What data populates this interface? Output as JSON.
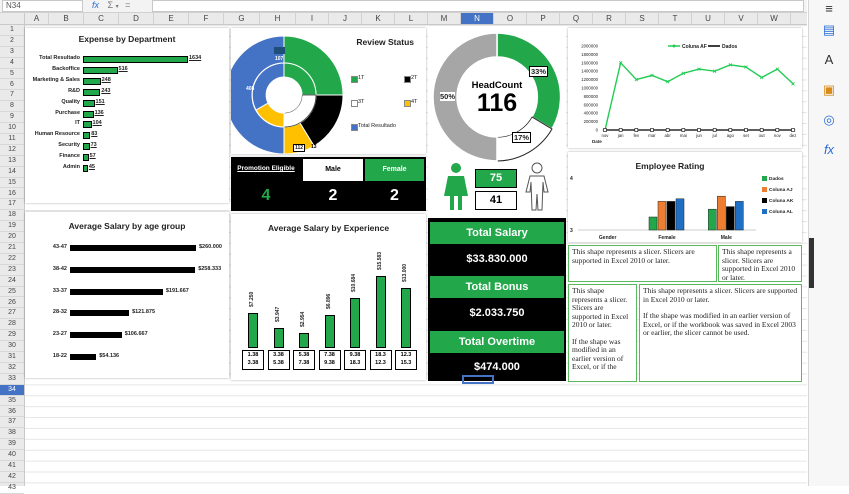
{
  "formula_bar": {
    "name_box": "N34",
    "fx_label": "fx",
    "sum_symbol": "Σ",
    "eq_symbol": "="
  },
  "columns": [
    "A",
    "B",
    "C",
    "D",
    "E",
    "F",
    "G",
    "H",
    "I",
    "J",
    "K",
    "L",
    "M",
    "N",
    "O",
    "P",
    "Q",
    "R",
    "S",
    "T",
    "U",
    "V",
    "W"
  ],
  "selected_column": "N",
  "rows": [
    "1",
    "2",
    "3",
    "4",
    "5",
    "6",
    "7",
    "8",
    "9",
    "10",
    "11",
    "12",
    "13",
    "14",
    "15",
    "16",
    "17",
    "18",
    "19",
    "20",
    "21",
    "22",
    "23",
    "24",
    "25",
    "26",
    "27",
    "28",
    "29",
    "30",
    "31",
    "32",
    "33",
    "34",
    "35",
    "36",
    "37",
    "38",
    "39",
    "40",
    "41",
    "42",
    "43"
  ],
  "selected_row": "34",
  "expense": {
    "title": "Expense by Department",
    "items": [
      {
        "label": "Total Resultado",
        "value": 1634
      },
      {
        "label": "Backoffice",
        "value": 516
      },
      {
        "label": "Marketing & Sales",
        "value": 248
      },
      {
        "label": "R&D",
        "value": 243
      },
      {
        "label": "Quality",
        "value": 151
      },
      {
        "label": "Purchase",
        "value": 136
      },
      {
        "label": "IT",
        "value": 104
      },
      {
        "label": "Human Resource",
        "value": 83
      },
      {
        "label": "Security",
        "value": 73
      },
      {
        "label": "Finance",
        "value": 57
      },
      {
        "label": "Admin",
        "value": 45
      }
    ],
    "bar_color": "#22a84a"
  },
  "review": {
    "title": "Review Status",
    "legend": [
      {
        "label": "1T",
        "color": "#22a84a"
      },
      {
        "label": "2T",
        "color": "#000000"
      },
      {
        "label": "3T",
        "color": "#ffffff"
      },
      {
        "label": "4T",
        "color": "#ffc000"
      },
      {
        "label": "Total Resultado",
        "color": "#4472c4"
      }
    ],
    "inner_labels": [
      "107",
      "13"
    ],
    "outer_labels": [
      "408",
      "112"
    ]
  },
  "headcount": {
    "title": "HeadCount",
    "value": "116",
    "pct_left": "50%",
    "pct_top": "33%",
    "pct_bottom": "17%",
    "female": "75",
    "male": "41"
  },
  "line_chart": {
    "legend": [
      "Coluna AF",
      "Dados"
    ],
    "x_label": "Date",
    "ylabels": [
      "2000000",
      "1800000",
      "1600000",
      "1400000",
      "1200000",
      "1000000",
      "800000",
      "600000",
      "400000",
      "200000",
      "0"
    ],
    "months": [
      "nov",
      "jan",
      "fev",
      "mar",
      "abr",
      "mai",
      "jun",
      "jul",
      "ago",
      "set",
      "out",
      "nov",
      "dez"
    ],
    "first_month_label": "nov",
    "chart_data": {
      "type": "line",
      "x": [
        "nov",
        "jan",
        "fev",
        "mar",
        "abr",
        "mai",
        "jun",
        "jul",
        "ago",
        "set",
        "out",
        "nov",
        "dez"
      ],
      "series": [
        {
          "name": "Coluna AF",
          "values": [
            0,
            1600000,
            1200000,
            1300000,
            1150000,
            1350000,
            1450000,
            1400000,
            1550000,
            1500000,
            1250000,
            1450000,
            1100000
          ],
          "color": "#22cc55"
        },
        {
          "name": "Dados",
          "values": [
            0,
            0,
            0,
            0,
            0,
            0,
            0,
            0,
            0,
            0,
            0,
            0,
            0
          ],
          "color": "#000000"
        }
      ],
      "ylim": [
        0,
        2000000
      ]
    }
  },
  "promotion": {
    "title": "Promotion Eligible",
    "male_label": "Male",
    "female_label": "Female",
    "total": "4",
    "male": "2",
    "female": "2"
  },
  "employee_rating": {
    "title": "Employee Rating",
    "y_top": "4",
    "y_bottom": "3",
    "categories": [
      "Gender",
      "Female",
      "Male"
    ],
    "legend": [
      {
        "label": "Dados",
        "color": "#22a84a"
      },
      {
        "label": "Coluna AJ",
        "color": "#ed7d31"
      },
      {
        "label": "Coluna AK",
        "color": "#000000"
      },
      {
        "label": "Coluna AL",
        "color": "#1f6fc5"
      }
    ],
    "chart_data": {
      "type": "bar",
      "categories": [
        "Gender",
        "Female",
        "Male"
      ],
      "series": [
        {
          "name": "Dados",
          "values": [
            null,
            3.25,
            3.4
          ]
        },
        {
          "name": "Coluna AJ",
          "values": [
            null,
            3.55,
            3.65
          ]
        },
        {
          "name": "Coluna AK",
          "values": [
            null,
            3.55,
            3.45
          ]
        },
        {
          "name": "Coluna AL",
          "values": [
            null,
            3.6,
            3.55
          ]
        }
      ],
      "ylim": [
        3,
        4
      ]
    }
  },
  "age_salary": {
    "title": "Average Salary by age group",
    "items": [
      {
        "label": "43-47",
        "value": 260000,
        "text": "$260.000"
      },
      {
        "label": "38-42",
        "value": 258333,
        "text": "$258.333"
      },
      {
        "label": "33-37",
        "value": 191667,
        "text": "$191.667"
      },
      {
        "label": "28-32",
        "value": 121875,
        "text": "$121.875"
      },
      {
        "label": "23-27",
        "value": 106667,
        "text": "$106.667"
      },
      {
        "label": "18-22",
        "value": 54136,
        "text": "$54.136"
      }
    ]
  },
  "exp_salary": {
    "title": "Average Salary by Experience",
    "bars": [
      {
        "value": 7250,
        "text": "$7.250",
        "l1": "1.38",
        "l2": "3.38"
      },
      {
        "value": 3947,
        "text": "$3.947",
        "l1": "3.38",
        "l2": "5.38"
      },
      {
        "value": 2954,
        "text": "$2.954",
        "l1": "5.38",
        "l2": "7.38"
      },
      {
        "value": 6896,
        "text": "$6.896",
        "l1": "7.38",
        "l2": "9.38"
      },
      {
        "value": 10684,
        "text": "$10.684",
        "l1": "9.38",
        "l2": "18.3"
      },
      {
        "value": 15583,
        "text": "$15.583",
        "l1": "18.3",
        "l2": "12.3"
      },
      {
        "value": 13000,
        "text": "$13.000",
        "l1": "12.3",
        "l2": "15.3"
      }
    ]
  },
  "totals": {
    "salary_label": "Total Salary",
    "salary_value": "$33.830.000",
    "bonus_label": "Total Bonus",
    "bonus_value": "$2.033.750",
    "overtime_label": "Total Overtime",
    "overtime_value": "$474.000"
  },
  "slicers": {
    "s1": "This shape represents a slicer. Slicers are supported in Excel 2010 or later.",
    "s2": "This shape represents a slicer. Slicers are supported in Excel 2010 or later.",
    "s3": "This shape represents a slicer. Slicers are supported in Excel 2010 or later.",
    "s3b": "If the shape was modified in an earlier version of Excel, or if the",
    "s4": "This shape represents a slicer. Slicers are supported in Excel 2010 or later.",
    "s4b": "If the shape was modified in an earlier version of Excel, or if the workbook was saved in Excel 2003 or earlier, the slicer cannot be used."
  }
}
